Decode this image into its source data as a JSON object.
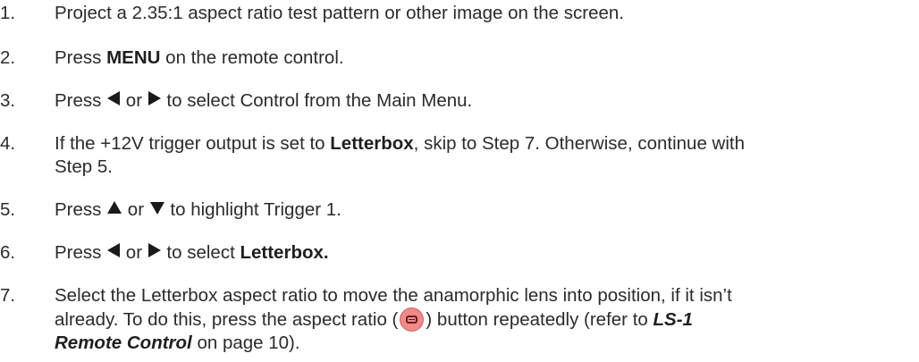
{
  "steps": [
    {
      "number": "1.",
      "text": "Project a 2.35:1 aspect ratio test pattern or other image on the screen."
    },
    {
      "number": "2.",
      "pre": "Press ",
      "bold": "MENU",
      "post": " on the remote control."
    },
    {
      "number": "3.",
      "pre": "Press ",
      "mid": " or ",
      "post": " to select Control from the Main Menu.",
      "icons": [
        "left-arrow",
        "right-arrow"
      ]
    },
    {
      "number": "4.",
      "pre": "If the +12V trigger output is set to ",
      "bold": "Letterbox",
      "post": ", skip to Step 7. Otherwise, continue with",
      "line2": "Step 5."
    },
    {
      "number": "5.",
      "pre": "Press ",
      "mid": " or ",
      "post": " to highlight Trigger 1.",
      "icons": [
        "up-arrow",
        "down-arrow"
      ]
    },
    {
      "number": "6.",
      "pre": "Press ",
      "mid": " or ",
      "post": " to select ",
      "bold": "Letterbox.",
      "icons": [
        "left-arrow",
        "right-arrow"
      ]
    },
    {
      "number": "7.",
      "line1": "Select the Letterbox aspect ratio to move the anamorphic lens into position, if it isn’t",
      "line2_pre": "already. To do this, press the aspect ratio (",
      "line2_post": ") button repeatedly (refer to ",
      "ref_bold": "LS-1",
      "ref_bold2": "Remote Control",
      "line3_post": " on page 10).",
      "icon": "aspect-ratio-button-icon"
    }
  ]
}
